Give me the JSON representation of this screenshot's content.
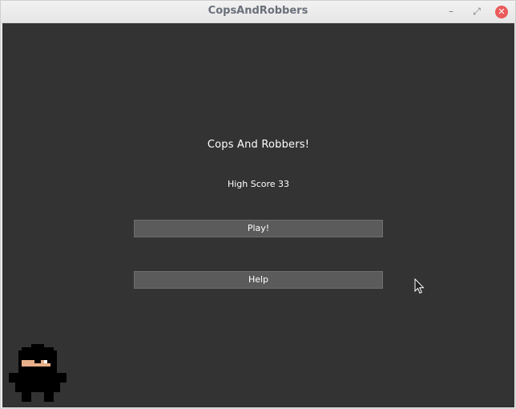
{
  "window": {
    "title": "CopsAndRobbers",
    "controls": {
      "minimize_icon": "minimize-icon",
      "maximize_icon": "maximize-icon",
      "close_icon": "close-icon",
      "minimize_glyph": "–",
      "maximize_glyph": "⤢",
      "close_glyph": "✕"
    }
  },
  "menu": {
    "title": "Cops And Robbers!",
    "high_score_label": "High Score 33",
    "play_label": "Play!",
    "help_label": "Help"
  },
  "colors": {
    "background": "#333333",
    "button": "#5b5b5b",
    "text": "#ffffff",
    "close_button": "#ea5b5b"
  },
  "sprite": {
    "name": "robber-sprite"
  }
}
